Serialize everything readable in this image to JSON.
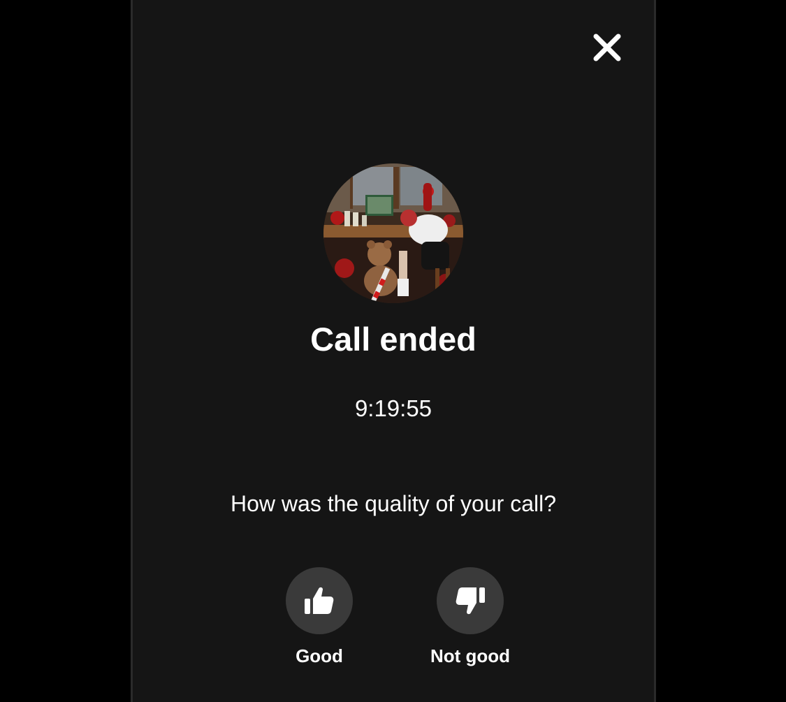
{
  "screen": {
    "close_icon": "close-icon",
    "title": "Call ended",
    "duration": "9:19:55",
    "question": "How was the quality of your call?"
  },
  "feedback": {
    "good": {
      "label": "Good",
      "icon": "thumbs-up-icon"
    },
    "not_good": {
      "label": "Not good",
      "icon": "thumbs-down-icon"
    }
  },
  "colors": {
    "page_background": "#000000",
    "panel_background": "#151515",
    "button_background": "#3a3a3a",
    "text": "#ffffff"
  }
}
